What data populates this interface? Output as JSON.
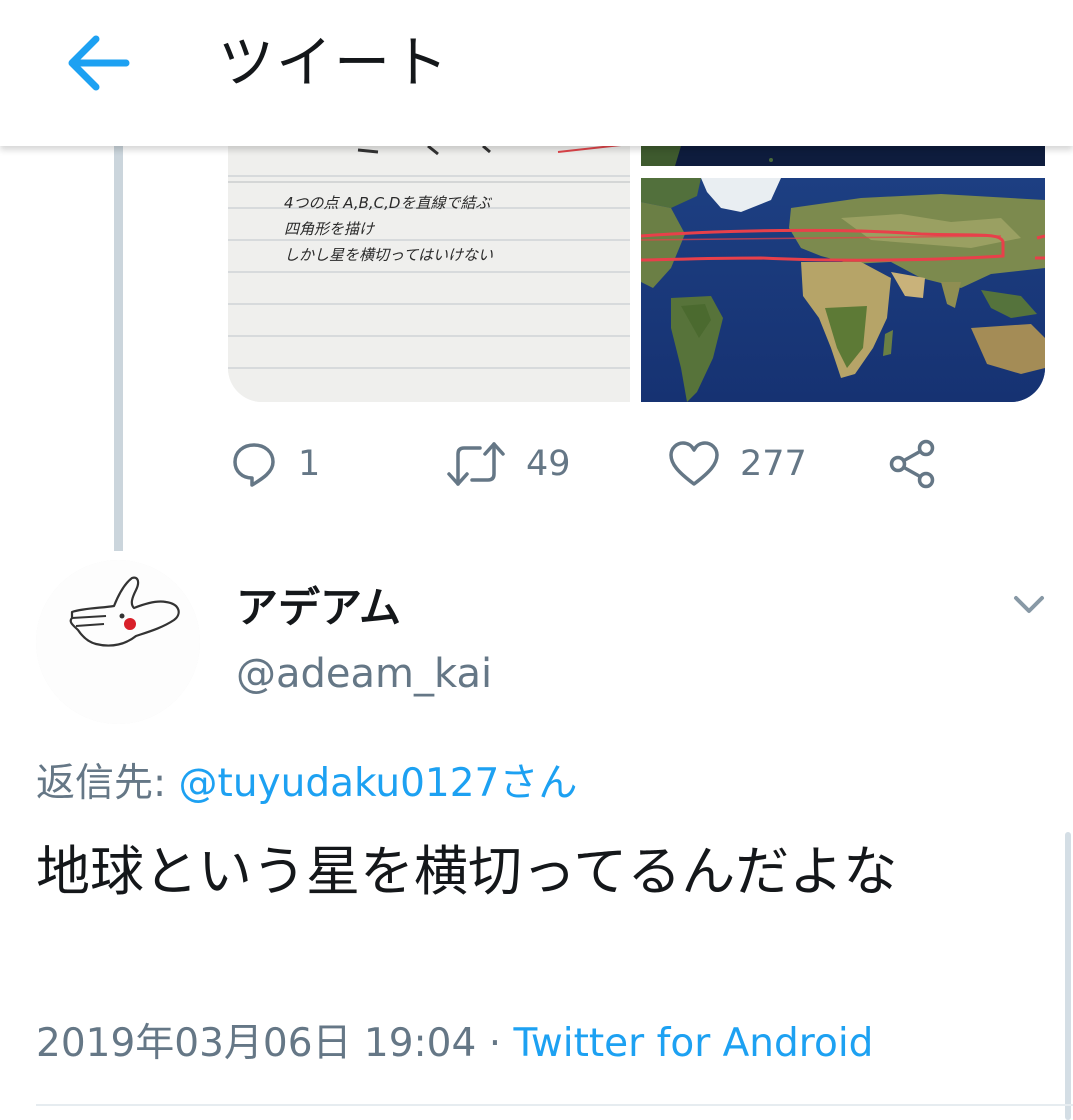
{
  "header": {
    "title": "ツイート",
    "back_icon": "arrow-left-icon"
  },
  "colors": {
    "accent": "#1da1f2",
    "secondary_text": "#657786",
    "primary_text": "#14171a",
    "thread_line": "#cbd5dc"
  },
  "media": {
    "left_image_text": [
      "4つの点 A,B,C,Dを直線で結ぶ",
      "四角形を描け",
      "しかし星を横切ってはいけない"
    ],
    "right_image": "world-map-satellite-image"
  },
  "actions": {
    "reply_count": "1",
    "retweet_count": "49",
    "like_count": "277",
    "icons": [
      "reply-icon",
      "retweet-icon",
      "like-icon",
      "share-icon"
    ]
  },
  "reply_tweet": {
    "display_name": "アデアム",
    "handle": "@adeam_kai",
    "reply_to_prefix": "返信先: ",
    "reply_to_mention": "@tuyudaku0127さん",
    "text": "地球という星を横切ってるんだよな",
    "timestamp": "2019年03月06日 19:04",
    "separator": " · ",
    "source": "Twitter for Android"
  }
}
